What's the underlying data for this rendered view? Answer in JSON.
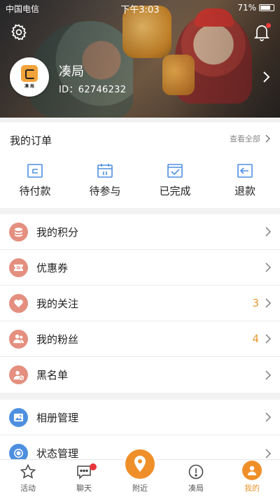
{
  "status_bar": {
    "carrier": "中国电信",
    "time": "下午3:03",
    "battery": "71%"
  },
  "header": {
    "nickname": "凑局",
    "user_id": "ID：62746232",
    "avatar_logo_text": "凑 局"
  },
  "orders": {
    "title": "我的订单",
    "view_all": "查看全部",
    "tabs": [
      {
        "label": "待付款",
        "icon": "wallet-icon"
      },
      {
        "label": "待参与",
        "icon": "calendar-icon"
      },
      {
        "label": "已完成",
        "icon": "completed-check-icon"
      },
      {
        "label": "退款",
        "icon": "refund-icon"
      }
    ]
  },
  "menu_group1": [
    {
      "label": "我的积分",
      "icon": "coins-icon",
      "color": "#e48f7f",
      "count": ""
    },
    {
      "label": "优惠券",
      "icon": "coupon-icon",
      "color": "#e48f7f",
      "count": ""
    },
    {
      "label": "我的关注",
      "icon": "heart-icon",
      "color": "#e48f7f",
      "count": "3"
    },
    {
      "label": "我的粉丝",
      "icon": "fans-icon",
      "color": "#e48f7f",
      "count": "4"
    },
    {
      "label": "黑名单",
      "icon": "blocked-user-icon",
      "color": "#e48f7f",
      "count": ""
    }
  ],
  "menu_group2": [
    {
      "label": "相册管理",
      "icon": "album-icon",
      "color": "#4e8fe0"
    },
    {
      "label": "状态管理",
      "icon": "status-icon",
      "color": "#4e8fe0"
    }
  ],
  "tabbar": [
    {
      "label": "活动",
      "icon": "star-icon"
    },
    {
      "label": "聊天",
      "icon": "chat-icon"
    },
    {
      "label": "附近",
      "icon": "location-pin-icon"
    },
    {
      "label": "凑局",
      "icon": "info-icon"
    },
    {
      "label": "我的",
      "icon": "profile-icon"
    }
  ],
  "colors": {
    "accent": "#ef8f2a",
    "count": "#e8962e",
    "menu_red": "#e48f7f",
    "menu_blue": "#4e8fe0"
  }
}
